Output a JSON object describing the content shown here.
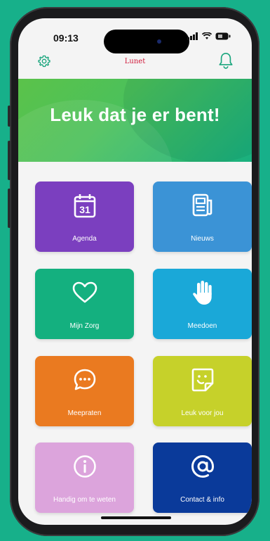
{
  "status_bar": {
    "time": "09:13"
  },
  "header": {
    "logo": "Lunet",
    "settings_icon": "gear-icon",
    "notifications_icon": "bell-icon"
  },
  "banner": {
    "title": "Leuk dat je er bent!"
  },
  "tiles": [
    {
      "label": "Agenda",
      "icon": "calendar-icon",
      "icon_text": "31",
      "color": "#7b3fbf"
    },
    {
      "label": "Nieuws",
      "icon": "newspaper-icon",
      "color": "#3b93d6"
    },
    {
      "label": "Mijn Zorg",
      "icon": "heart-icon",
      "color": "#14b07f"
    },
    {
      "label": "Meedoen",
      "icon": "hand-icon",
      "color": "#1aa8d8"
    },
    {
      "label": "Meepraten",
      "icon": "chat-icon",
      "color": "#ea7a20"
    },
    {
      "label": "Leuk voor jou",
      "icon": "sticker-icon",
      "color": "#c6d12a"
    },
    {
      "label": "Handig om te weten",
      "icon": "info-icon",
      "color": "#dca4dc"
    },
    {
      "label": "Contact & info",
      "icon": "at-icon",
      "color": "#0a3a9a"
    }
  ],
  "colors": {
    "background": "#17b08a",
    "screen": "#f4f4f4",
    "banner_start": "#5bc24a",
    "banner_end": "#19b07f"
  }
}
